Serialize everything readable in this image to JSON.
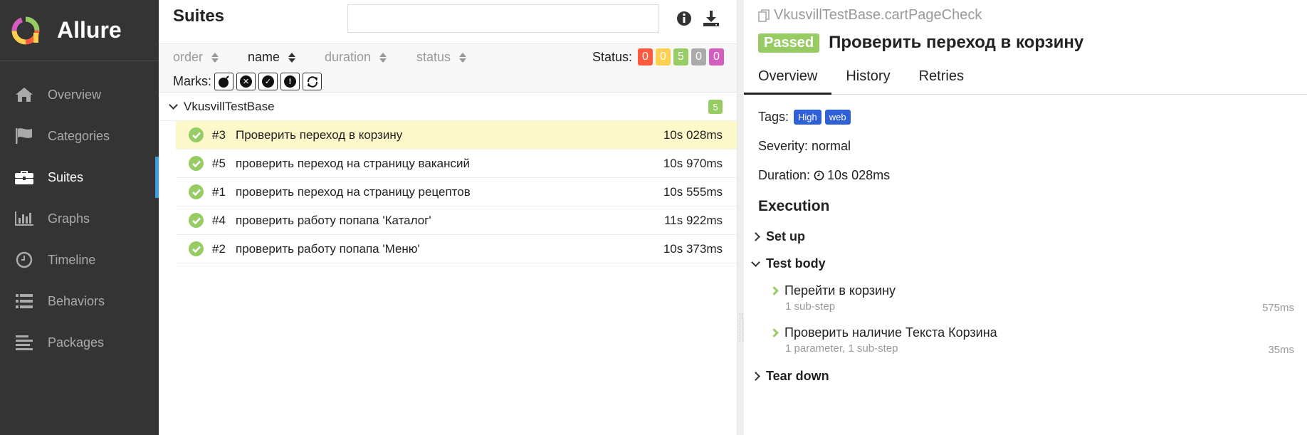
{
  "sidebar": {
    "brand": "Allure",
    "items": [
      {
        "label": "Overview",
        "icon": "home-icon",
        "active": false
      },
      {
        "label": "Categories",
        "icon": "flag-icon",
        "active": false
      },
      {
        "label": "Suites",
        "icon": "briefcase-icon",
        "active": true
      },
      {
        "label": "Graphs",
        "icon": "bar-chart-icon",
        "active": false
      },
      {
        "label": "Timeline",
        "icon": "clock-icon",
        "active": false
      },
      {
        "label": "Behaviors",
        "icon": "list-icon",
        "active": false
      },
      {
        "label": "Packages",
        "icon": "align-left-icon",
        "active": false
      }
    ]
  },
  "suites": {
    "title": "Suites",
    "search_placeholder": "",
    "sort": {
      "order": "order",
      "name": "name",
      "duration": "duration",
      "status": "status"
    },
    "status_label": "Status:",
    "status_counts": [
      {
        "value": "0",
        "color": "#fd5a3e"
      },
      {
        "value": "0",
        "color": "#ffd050"
      },
      {
        "value": "5",
        "color": "#97cc64"
      },
      {
        "value": "0",
        "color": "#aaaaaa"
      },
      {
        "value": "0",
        "color": "#d35ebe"
      }
    ],
    "marks_label": "Marks:",
    "group": {
      "name": "VkusvillTestBase",
      "count": "5"
    },
    "rows": [
      {
        "num": "#3",
        "name": "Проверить переход в корзину",
        "duration": "10s 028ms",
        "selected": true
      },
      {
        "num": "#5",
        "name": "проверить переход на страницу вакансий",
        "duration": "10s 970ms",
        "selected": false
      },
      {
        "num": "#1",
        "name": "проверить переход на страницу рецептов",
        "duration": "10s 555ms",
        "selected": false
      },
      {
        "num": "#4",
        "name": "проверить работу попапа 'Каталог'",
        "duration": "11s 922ms",
        "selected": false
      },
      {
        "num": "#2",
        "name": "проверить работу попапа 'Меню'",
        "duration": "10s 373ms",
        "selected": false
      }
    ]
  },
  "detail": {
    "breadcrumb": "VkusvillTestBase.cartPageCheck",
    "status": "Passed",
    "title": "Проверить переход в корзину",
    "tabs": [
      "Overview",
      "History",
      "Retries"
    ],
    "tags_label": "Tags:",
    "tags": [
      "High",
      "web"
    ],
    "severity": "Severity: normal",
    "duration_label": "Duration:",
    "duration": "10s 028ms",
    "execution_heading": "Execution",
    "setup": "Set up",
    "test_body": "Test body",
    "steps": [
      {
        "title": "Перейти в корзину",
        "sub": "1 sub-step",
        "duration": "575ms"
      },
      {
        "title": "Проверить наличие Текста Корзина",
        "sub": "1 parameter, 1 sub-step",
        "duration": "35ms"
      }
    ],
    "teardown": "Tear down"
  }
}
